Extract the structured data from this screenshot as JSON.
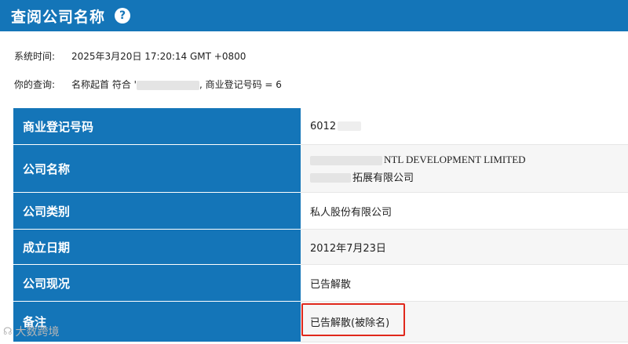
{
  "header": {
    "title": "查阅公司名称",
    "help_glyph": "?"
  },
  "meta": {
    "time_label": "系统时间:",
    "time_value": "2025年3月20日 17:20:14 GMT +0800",
    "query_label": "你的查询:",
    "query_prefix": "名称起首 符合 '",
    "query_suffix": ", 商业登记号码 = 6"
  },
  "table": {
    "rows": [
      {
        "label": "商业登记号码",
        "value": "6012"
      },
      {
        "label": "公司名称",
        "value_en": "NTL DEVELOPMENT LIMITED",
        "value_zh": "拓展有限公司"
      },
      {
        "label": "公司类别",
        "value": "私人股份有限公司"
      },
      {
        "label": "成立日期",
        "value": "2012年7月23日"
      },
      {
        "label": "公司现况",
        "value": "已告解散"
      },
      {
        "label": "备注",
        "value": "已告解散(被除名)"
      }
    ]
  },
  "watermark": {
    "logo": "☊",
    "text": "大数跨境"
  },
  "colors": {
    "header_bg": "#1475b8",
    "highlight": "#e0281c"
  }
}
